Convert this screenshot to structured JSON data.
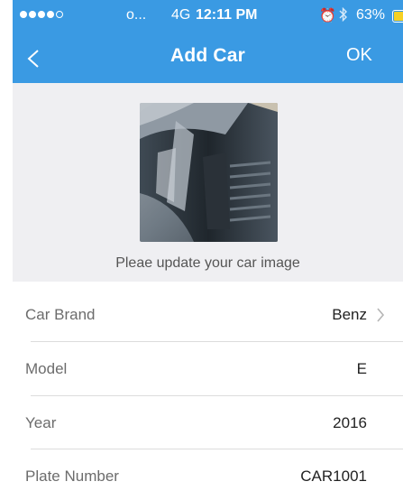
{
  "colors": {
    "header_bg": "#3a9ae3",
    "image_bg": "#efeff2",
    "battery": "#f5d024"
  },
  "status_bar": {
    "carrier": "o...",
    "network": "4G",
    "time": "12:11 PM",
    "battery_percent": "63%",
    "signal_bars": 4,
    "signal_max": 5
  },
  "nav": {
    "title": "Add Car",
    "ok_label": "OK",
    "back_icon": "chevron-left-icon"
  },
  "car_image": {
    "caption": "Pleae update your car image"
  },
  "form": [
    {
      "label": "Car Brand",
      "value": "Benz",
      "has_chevron": true
    },
    {
      "label": "Model",
      "value": "E",
      "has_chevron": false
    },
    {
      "label": "Year",
      "value": "2016",
      "has_chevron": false
    },
    {
      "label": "Plate Number",
      "value": "CAR1001",
      "has_chevron": false
    }
  ]
}
